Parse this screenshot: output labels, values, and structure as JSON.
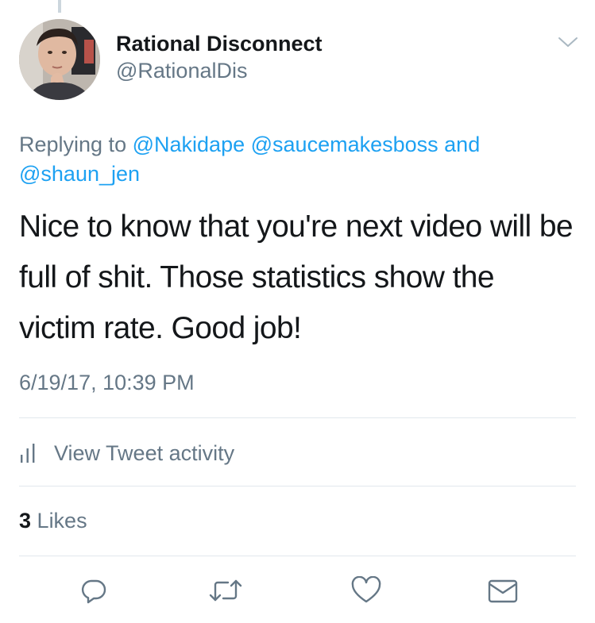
{
  "tweet": {
    "display_name": "Rational Disconnect",
    "handle": "@RationalDis",
    "replying_prefix": "Replying to",
    "mentions": [
      "@Nakidape",
      "@saucemakesboss",
      "@shaun_jen"
    ],
    "mentions_joiner": "and",
    "text": "Nice to know that you're next video will be full of shit. Those statistics show the victim rate. Good job!",
    "timestamp": "6/19/17, 10:39 PM"
  },
  "activity": {
    "label": "View Tweet activity",
    "icon": "bar-chart-icon"
  },
  "likes": {
    "count": "3",
    "label": "Likes"
  },
  "actions": [
    {
      "name": "reply",
      "icon": "reply-icon"
    },
    {
      "name": "retweet",
      "icon": "retweet-icon"
    },
    {
      "name": "like",
      "icon": "heart-icon"
    },
    {
      "name": "message",
      "icon": "envelope-icon"
    }
  ],
  "colors": {
    "link": "#1da1f2",
    "secondary_text": "#657786",
    "primary_text": "#14171a",
    "divider": "#e1e8ed"
  }
}
